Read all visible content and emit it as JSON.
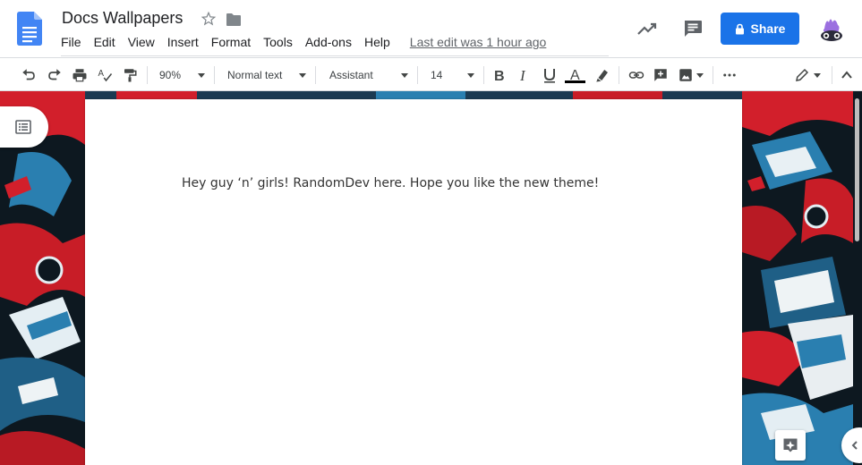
{
  "header": {
    "title": "Docs Wallpapers",
    "menu": [
      "File",
      "Edit",
      "View",
      "Insert",
      "Format",
      "Tools",
      "Add-ons",
      "Help"
    ],
    "last_edit": "Last edit was 1 hour ago",
    "share_label": "Share",
    "share_color": "#1a73e8"
  },
  "toolbar": {
    "zoom": "90%",
    "style": "Normal text",
    "font": "Assistant",
    "font_size": "14"
  },
  "document": {
    "text": "Hey guy ‘n’ girls! RandomDev here. Hope you like the new theme!"
  },
  "icons": {
    "header": [
      "docs-logo-icon",
      "star-icon",
      "folder-icon",
      "activity-trend-icon",
      "comment-icon",
      "lock-icon",
      "avatar"
    ],
    "toolbar": [
      "undo-icon",
      "redo-icon",
      "print-icon",
      "spellcheck-icon",
      "paint-format-icon",
      "bold-icon",
      "italic-icon",
      "underline-icon",
      "text-color-icon",
      "highlight-icon",
      "link-icon",
      "add-comment-icon",
      "image-icon",
      "more-icon",
      "editing-mode-icon",
      "collapse-icon"
    ],
    "side": [
      "outline-icon",
      "explore-icon",
      "chevron-left-icon"
    ]
  },
  "colors": {
    "wallpaper_red": "#d21f2b",
    "wallpaper_blue": "#2a7fb0",
    "wallpaper_dark": "#0d1820"
  }
}
